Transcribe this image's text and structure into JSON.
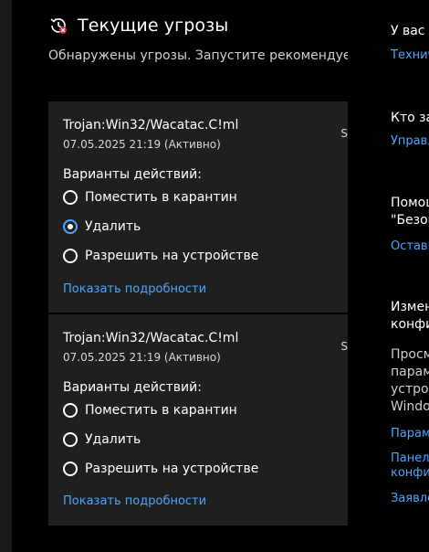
{
  "header": {
    "title": "Текущие угрозы",
    "subtitle": "Обнаружены угрозы. Запустите рекомендуемые"
  },
  "threats": [
    {
      "name": "Trojan:Win32/Wacatac.C!ml",
      "date": "07.05.2025 21:19 (Активно)",
      "severity": "S",
      "actions_label": "Варианты действий:",
      "options": [
        "Поместить в карантин",
        "Удалить",
        "Разрешить на устройстве"
      ],
      "selected": "Удалить",
      "details_link": "Показать подробности"
    },
    {
      "name": "Trojan:Win32/Wacatac.C!ml",
      "date": "07.05.2025 21:19 (Активно)",
      "severity": "S",
      "actions_label": "Варианты действий:",
      "options": [
        "Поместить в карантин",
        "Удалить",
        "Разрешить на устройстве"
      ],
      "selected": "",
      "details_link": "Показать подробности"
    }
  ],
  "right_panel": {
    "q1": "У вас е",
    "q1_link": "Технич",
    "q2": "Кто за",
    "q2_link": "Управл",
    "help_1": "Помощ",
    "help_2": "\"Безоп",
    "help_link": "Остави",
    "change_1": "Измен",
    "change_2": "конфи",
    "view_1": "Просм",
    "view_2": "парам",
    "view_3": "устрой",
    "view_4": "Windo",
    "link_a": "Парам",
    "link_b1": "Панел",
    "link_b2": "конфи",
    "link_c": "Заявле"
  },
  "colors": {
    "accent": "#4ba6ff",
    "card_bg": "#1f1f1f",
    "page_bg": "#000000"
  },
  "icons": {
    "header": "history-shield-icon"
  }
}
